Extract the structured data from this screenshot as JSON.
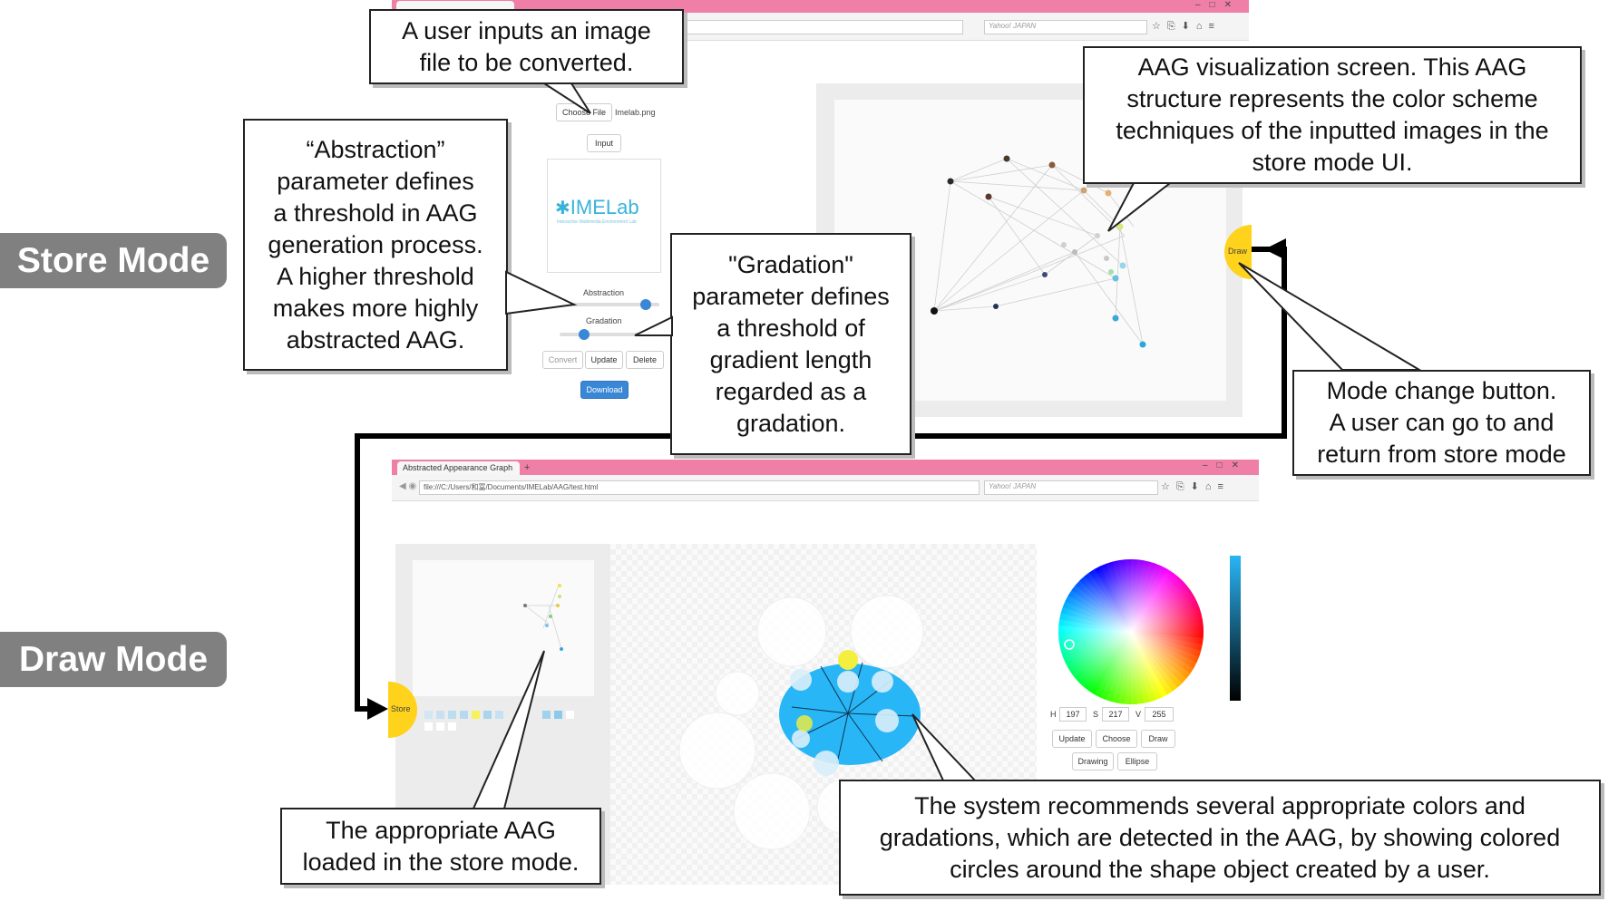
{
  "modes": {
    "store_label": "Store Mode",
    "draw_label": "Draw Mode"
  },
  "store_window": {
    "address_search": "Yahoo! JAPAN",
    "choose_file_button": "Choose File",
    "file_name": "Imelab.png",
    "input_button": "Input",
    "logo_text": "IMELab",
    "logo_subtitle": "Interactive Multimedia Environment Lab",
    "abstraction_label": "Abstraction",
    "gradation_label": "Gradation",
    "abstraction_value": 0.85,
    "gradation_value": 0.25,
    "convert_button": "Convert",
    "update_button": "Update",
    "delete_button": "Delete",
    "download_button": "Download",
    "draw_toggle": "Draw"
  },
  "draw_window": {
    "tab_title": "Abstracted Appearance Graph",
    "new_tab": "+",
    "url": "file:///C:/Users/和冨/Documents/IMELab/AAG/test.html",
    "address_search": "Yahoo! JAPAN",
    "store_toggle": "Store",
    "h_label": "H",
    "h_value": "197",
    "s_label": "S",
    "s_value": "217",
    "v_label": "V",
    "v_value": "255",
    "update_button": "Update",
    "choose_button": "Choose",
    "draw_button": "Draw",
    "drawing_button": "Drawing",
    "ellipse_button": "Ellipse",
    "accent_color": "#29b6f6"
  },
  "callouts": {
    "input_image": "A user inputs an image file to be converted.",
    "abstraction": [
      "“Abstraction”",
      "parameter defines",
      "a threshold in AAG",
      "generation process.",
      "A higher threshold",
      "makes more highly",
      "abstracted AAG."
    ],
    "gradation": [
      "\"Gradation\"",
      "parameter defines",
      "a threshold of",
      "gradient length",
      "regarded as a",
      "gradation."
    ],
    "aag_visualization": [
      "AAG visualization screen. This AAG",
      "structure represents the color scheme",
      "techniques of the inputted images in the",
      "store mode UI."
    ],
    "mode_change": [
      "Mode change button.",
      "A user can go to and",
      "return from store mode"
    ],
    "appropriate_aag": [
      "The appropriate AAG",
      "loaded in the store mode."
    ],
    "recommend": [
      "The system recommends several appropriate colors and",
      "gradations, which are detected in the AAG, by showing colored",
      "circles around the shape object created by a user."
    ]
  }
}
